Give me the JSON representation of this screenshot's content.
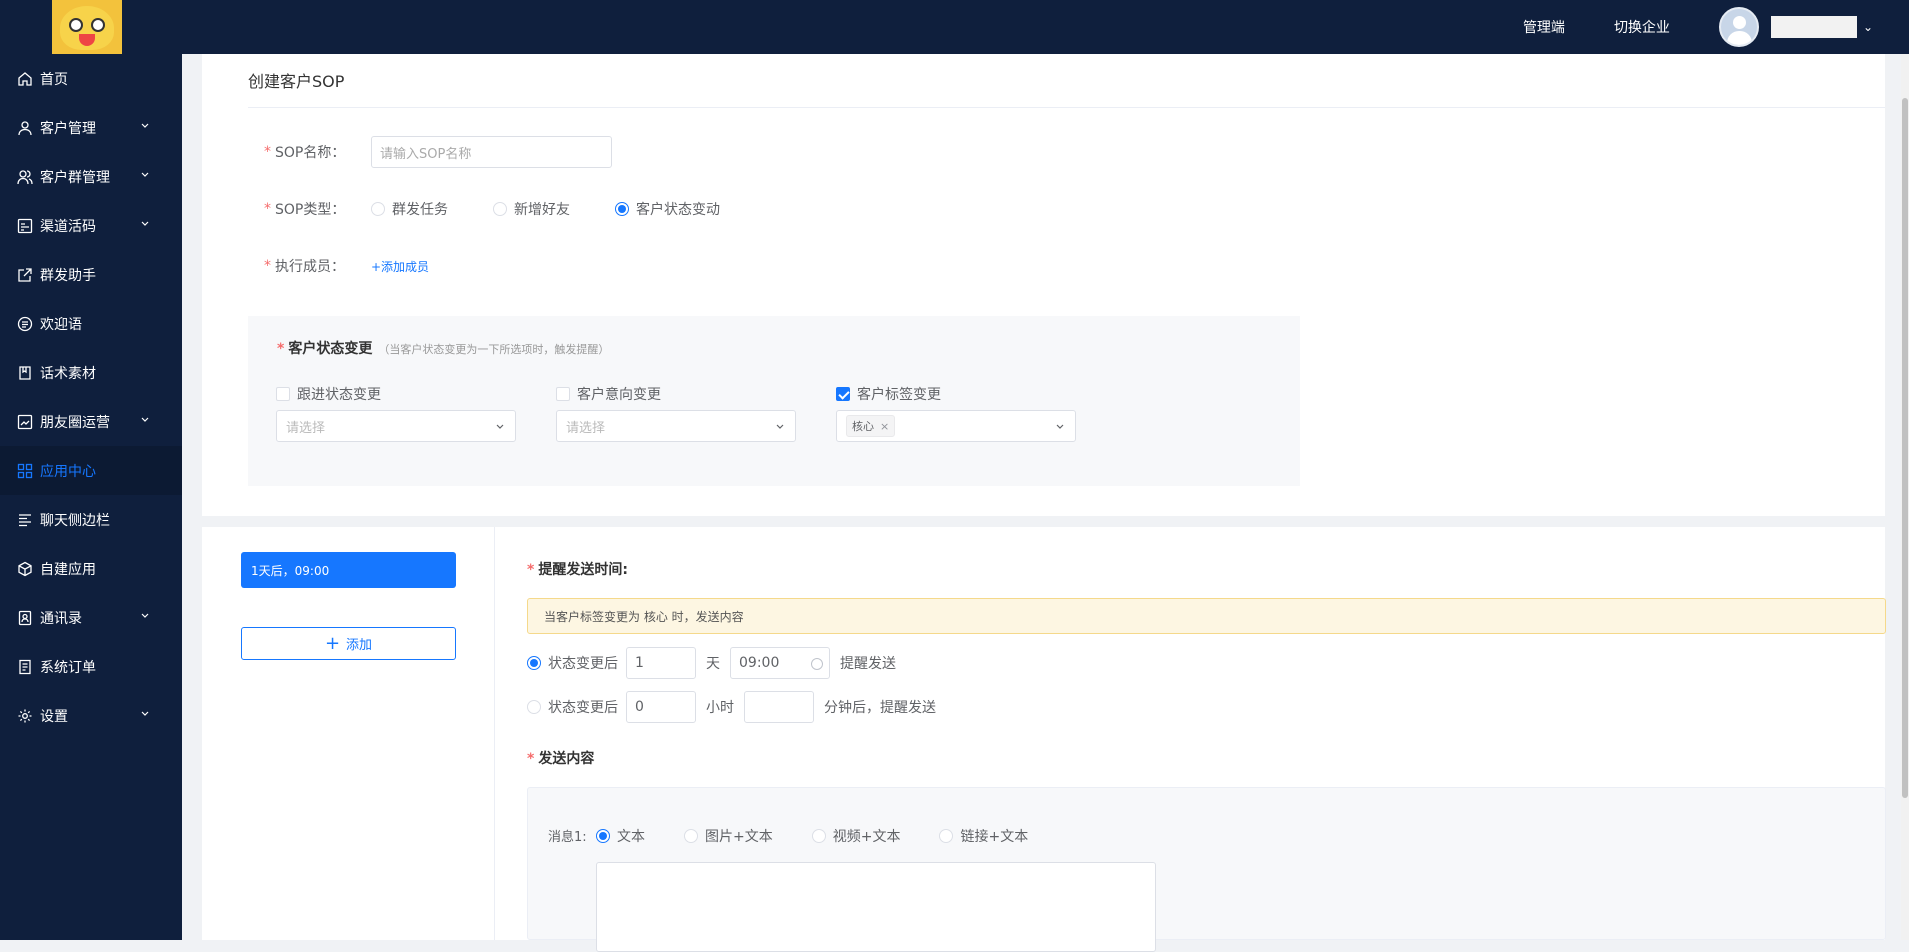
{
  "header": {
    "admin_link": "管理端",
    "switch_link": "切换企业",
    "user_name": ""
  },
  "sidebar": {
    "items": [
      {
        "label": "首页",
        "icon": "home-icon"
      },
      {
        "label": "客户管理",
        "icon": "user-icon"
      },
      {
        "label": "客户群管理",
        "icon": "group-icon"
      },
      {
        "label": "渠道活码",
        "icon": "qrcode-icon"
      },
      {
        "label": "群发助手",
        "icon": "share-icon"
      },
      {
        "label": "欢迎语",
        "icon": "message-icon"
      },
      {
        "label": "话术素材",
        "icon": "book-icon"
      },
      {
        "label": "朋友圈运营",
        "icon": "moments-icon"
      },
      {
        "label": "应用中心",
        "icon": "apps-icon"
      },
      {
        "label": "聊天侧边栏",
        "icon": "sidebar-icon"
      },
      {
        "label": "自建应用",
        "icon": "cube-icon"
      },
      {
        "label": "通讯录",
        "icon": "contacts-icon"
      },
      {
        "label": "系统订单",
        "icon": "order-icon"
      },
      {
        "label": "设置",
        "icon": "gear-icon"
      }
    ],
    "active": "应用中心",
    "accent": "#1677ff"
  },
  "form": {
    "title": "创建客户SOP",
    "name_label": "SOP名称：",
    "name_placeholder": "请输入SOP名称",
    "type_label": "SOP类型：",
    "type_options": [
      "群发任务",
      "新增好友",
      "客户状态变动"
    ],
    "type_selected": "客户状态变动",
    "member_label": "执行成员：",
    "member_add": "+添加成员"
  },
  "status_change": {
    "title": "客户状态变更",
    "hint": "（当客户状态变更为一下所选项时，触发提醒）",
    "follow_label": "跟进状态变更",
    "follow_placeholder": "请选择",
    "intent_label": "客户意向变更",
    "intent_placeholder": "请选择",
    "tag_label": "客户标签变更",
    "tag_value": "核心",
    "tag_close": "×"
  },
  "schedule": {
    "time_item": "1天后，09:00",
    "add_label": "添加",
    "remind_label": "提醒发送时间:",
    "notice": "当客户标签变更为 核心 时，发送内容",
    "row1": {
      "prefix": "状态变更后",
      "days": "1",
      "day_unit": "天",
      "time": "09:00",
      "suffix": "提醒发送"
    },
    "row2": {
      "prefix": "状态变更后",
      "hours": "0",
      "hour_unit": "小时",
      "minutes": "",
      "suffix": "分钟后，提醒发送"
    },
    "content_label": "发送内容",
    "msg_label": "消息1:",
    "msg_types": [
      "文本",
      "图片+文本",
      "视频+文本",
      "链接+文本"
    ],
    "msg_selected": "文本"
  }
}
